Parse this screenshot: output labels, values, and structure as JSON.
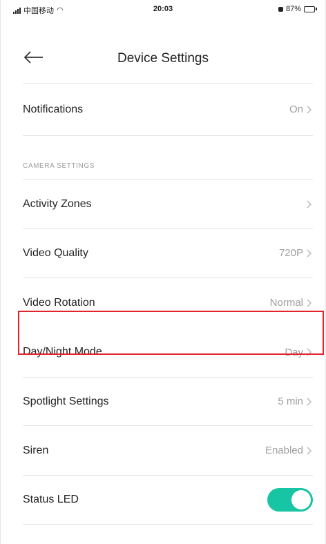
{
  "status_bar": {
    "carrier": "中国移动",
    "time": "20:03",
    "battery": "87%",
    "battery_level": 0.87
  },
  "header": {
    "title": "Device Settings"
  },
  "notifications": {
    "label": "Notifications",
    "value": "On"
  },
  "section": {
    "title": "CAMERA SETTINGS"
  },
  "rows": [
    {
      "label": "Activity Zones",
      "value": ""
    },
    {
      "label": "Video Quality",
      "value": "720P"
    },
    {
      "label": "Video Rotation",
      "value": "Normal"
    },
    {
      "label": "Day/Night Mode",
      "value": "Day"
    },
    {
      "label": "Spotlight Settings",
      "value": "5 min"
    },
    {
      "label": "Siren",
      "value": "Enabled"
    }
  ],
  "status_led": {
    "label": "Status LED",
    "enabled": true
  },
  "colors": {
    "accent": "#17c4a4",
    "highlight": "#e0242a",
    "value_text": "#9e9e9e"
  }
}
